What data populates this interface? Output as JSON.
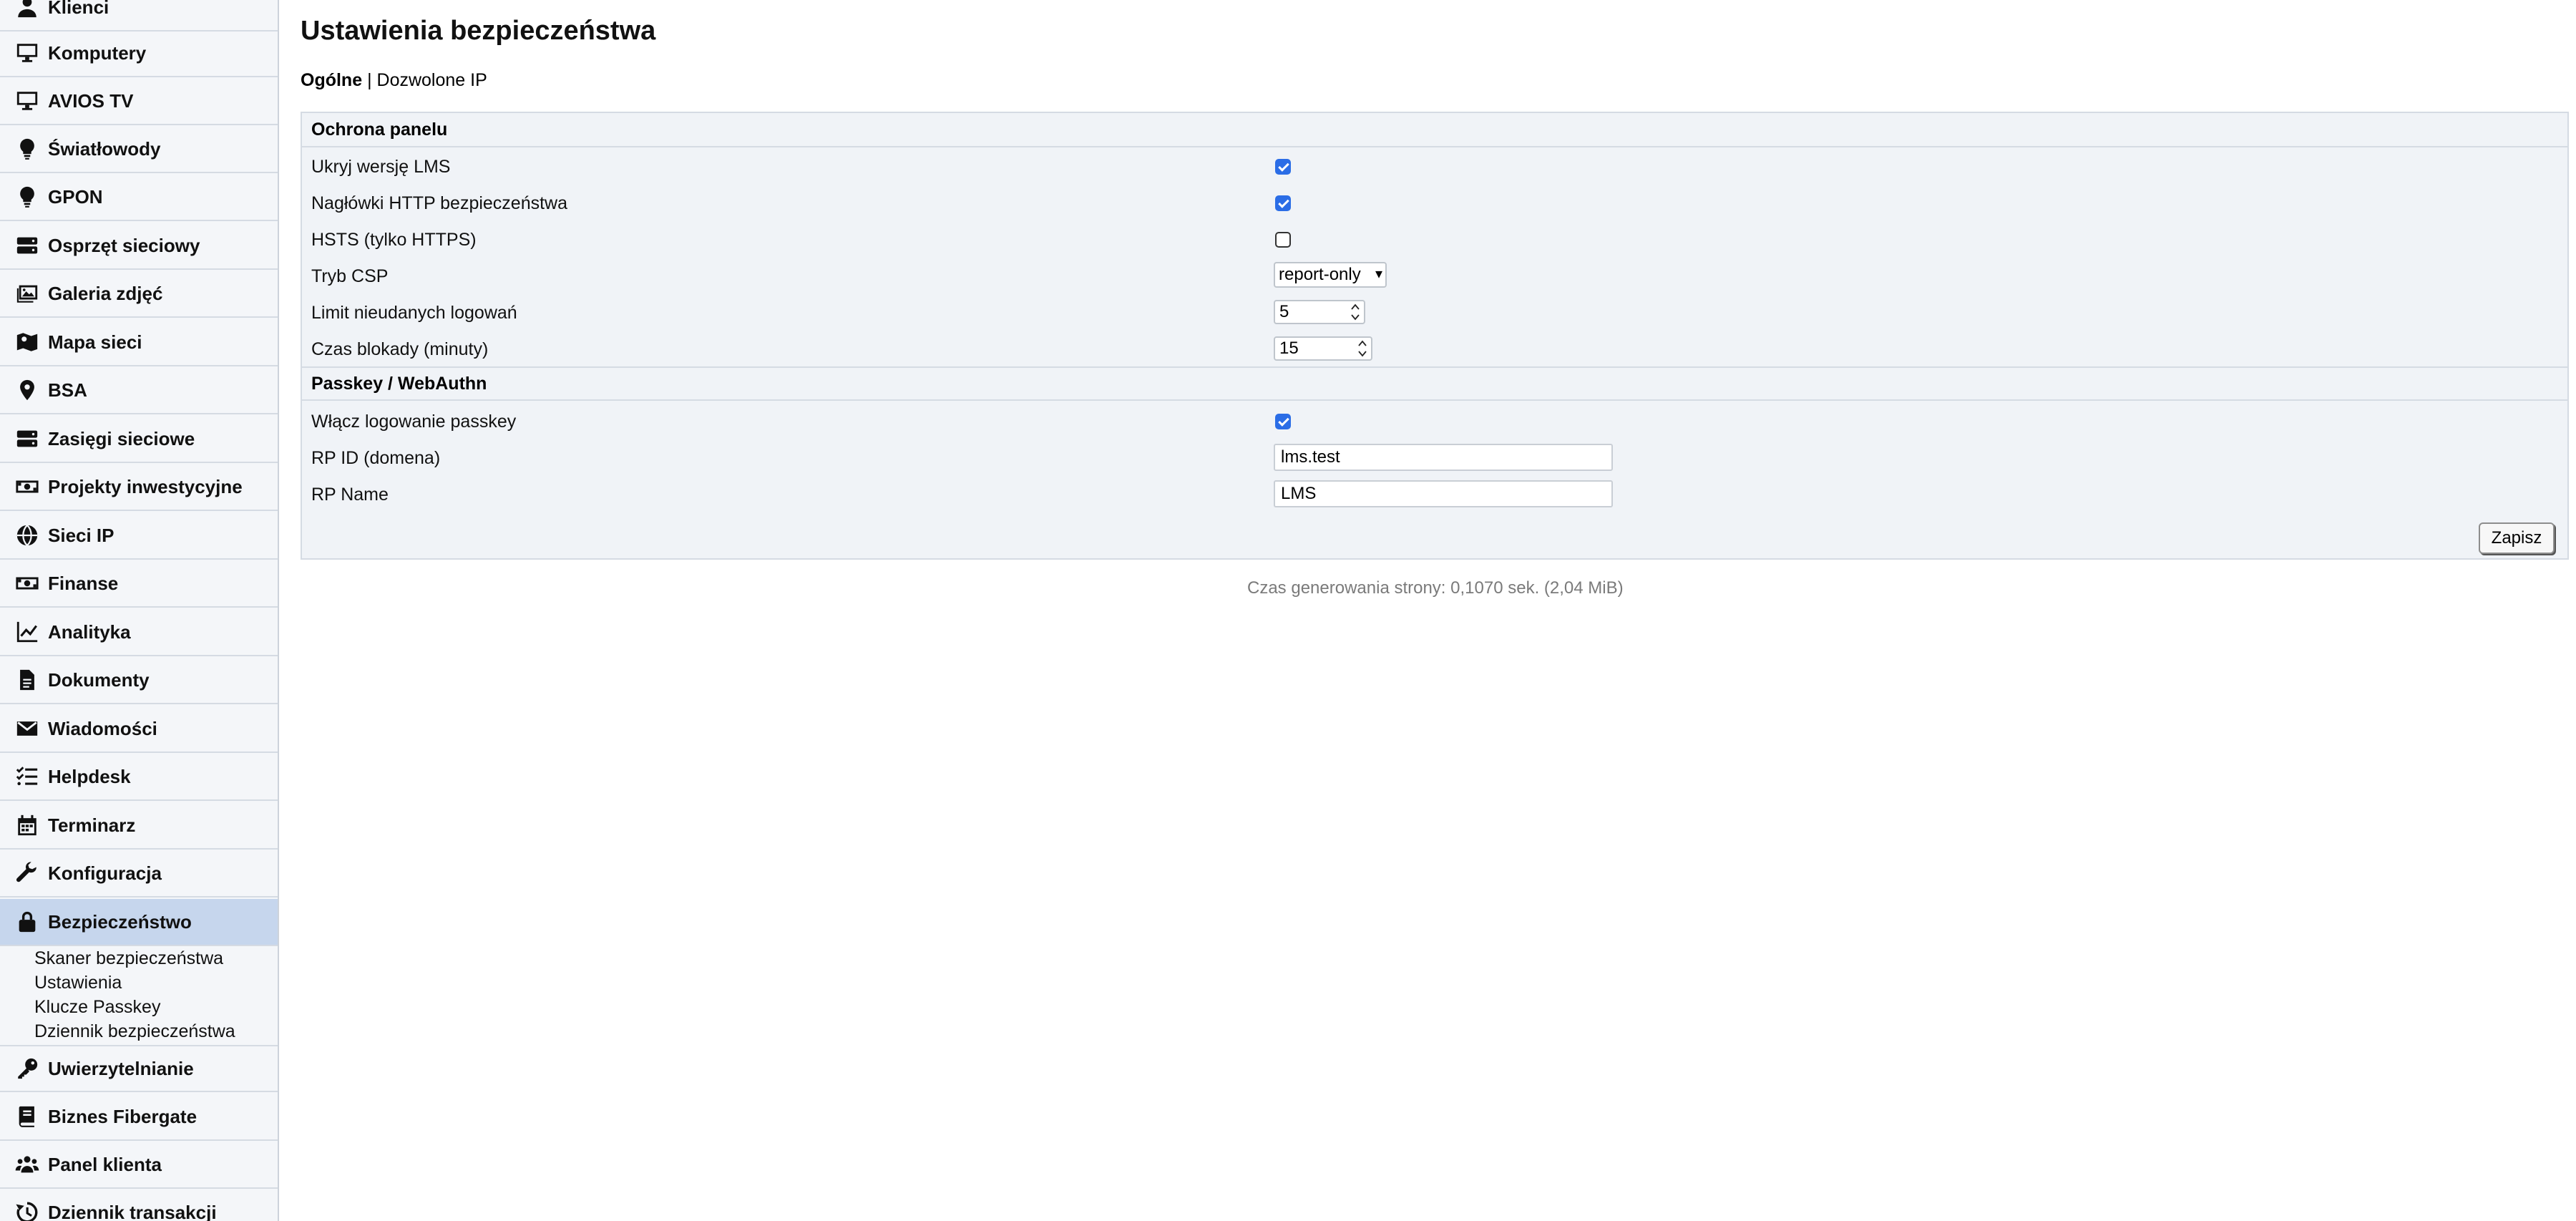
{
  "sidebar": {
    "items": [
      {
        "label": "Klienci",
        "icon": "person-icon"
      },
      {
        "label": "Komputery",
        "icon": "monitor-icon"
      },
      {
        "label": "AVIOS TV",
        "icon": "tv-icon"
      },
      {
        "label": "Światłowody",
        "icon": "lightbulb-icon"
      },
      {
        "label": "GPON",
        "icon": "lightbulb-icon"
      },
      {
        "label": "Osprzęt sieciowy",
        "icon": "server-icon"
      },
      {
        "label": "Galeria zdjęć",
        "icon": "images-icon"
      },
      {
        "label": "Mapa sieci",
        "icon": "map-icon"
      },
      {
        "label": "BSA",
        "icon": "map-pin-icon"
      },
      {
        "label": "Zasięgi sieciowe",
        "icon": "server-icon"
      },
      {
        "label": "Projekty inwestycyjne",
        "icon": "money-icon"
      },
      {
        "label": "Sieci IP",
        "icon": "globe-icon"
      },
      {
        "label": "Finanse",
        "icon": "money-icon"
      },
      {
        "label": "Analityka",
        "icon": "line-chart-icon"
      },
      {
        "label": "Dokumenty",
        "icon": "document-icon"
      },
      {
        "label": "Wiadomości",
        "icon": "envelope-icon"
      },
      {
        "label": "Helpdesk",
        "icon": "checklist-icon"
      },
      {
        "label": "Terminarz",
        "icon": "calendar-icon"
      },
      {
        "label": "Konfiguracja",
        "icon": "wrench-icon"
      },
      {
        "label": "Bezpieczeństwo",
        "icon": "lock-icon",
        "active": true
      },
      {
        "label": "Uwierzytelnianie",
        "icon": "key-icon"
      },
      {
        "label": "Biznes Fibergate",
        "icon": "book-icon"
      },
      {
        "label": "Panel klienta",
        "icon": "users-icon"
      },
      {
        "label": "Dziennik transakcji",
        "icon": "history-icon"
      }
    ],
    "subitems": [
      "Skaner bezpieczeństwa",
      "Ustawienia",
      "Klucze Passkey",
      "Dziennik bezpieczeństwa"
    ]
  },
  "main": {
    "title": "Ustawienia bezpieczeństwa",
    "tabs": {
      "active": "Ogólne",
      "separator": "|",
      "other": "Dozwolone IP"
    },
    "sections": {
      "panel_protection": {
        "heading": "Ochrona panelu",
        "hide_version": {
          "label": "Ukryj wersję LMS",
          "checked": true
        },
        "http_headers": {
          "label": "Nagłówki HTTP bezpieczeństwa",
          "checked": true
        },
        "hsts": {
          "label": "HSTS (tylko HTTPS)",
          "checked": false
        },
        "csp_mode": {
          "label": "Tryb CSP",
          "value": "report-only"
        },
        "login_limit": {
          "label": "Limit nieudanych logowań",
          "value": "5"
        },
        "lockout_time": {
          "label": "Czas blokady (minuty)",
          "value": "15"
        }
      },
      "passkey": {
        "heading": "Passkey / WebAuthn",
        "enable_passkey": {
          "label": "Włącz logowanie passkey",
          "checked": true
        },
        "rp_id": {
          "label": "RP ID (domena)",
          "value": "lms.test"
        },
        "rp_name": {
          "label": "RP Name",
          "value": "LMS"
        }
      }
    },
    "save_label": "Zapisz",
    "footer": "Czas generowania strony: 0,1070 sek. (2,04 MiB)"
  },
  "colors": {
    "accent": "#2b6de6",
    "sidebar_bg": "#f4f6f9",
    "sidebar_active": "#c6d6ed",
    "panel_bg": "#f0f3f7"
  }
}
